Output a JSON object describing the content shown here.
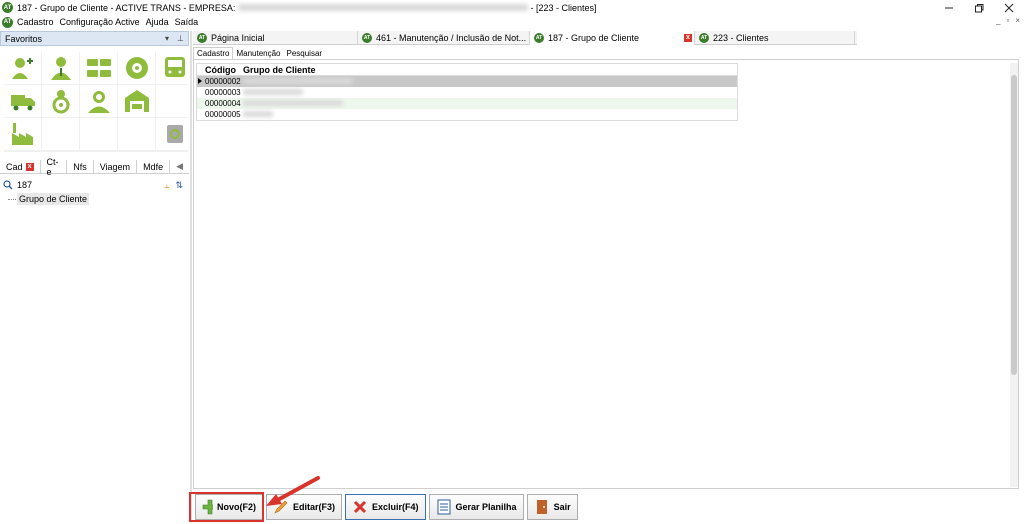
{
  "window": {
    "title_prefix": "187 - Grupo de Cliente - ACTIVE TRANS - EMPRESA:",
    "title_suffix": "- [223 - Clientes]",
    "logo_text": "AT"
  },
  "menu": {
    "items": [
      "Cadastro",
      "Configuração Active",
      "Ajuda",
      "Saída"
    ]
  },
  "favorites": {
    "title": "Favoritos",
    "icons": [
      "add-user-icon",
      "user-icon",
      "bus-fleet-icon",
      "tire-icon",
      "bus-front-icon",
      "truck-icon",
      "driver-icon",
      "mechanic-icon",
      "garage-icon",
      "factory-icon",
      "recycle-icon"
    ]
  },
  "categories": {
    "tabs": [
      "Cad",
      "Ct-e",
      "Nfs",
      "Viagem",
      "Mdfe"
    ]
  },
  "search": {
    "value": "187"
  },
  "tree": {
    "node": "Grupo de Cliente"
  },
  "doc_tabs": [
    {
      "label": "Página Inicial"
    },
    {
      "label": "461 - Manutenção / Inclusão de Not..."
    },
    {
      "label": "187 - Grupo de Cliente"
    },
    {
      "label": "223 - Clientes"
    }
  ],
  "sub_tabs": [
    "Cadastro",
    "Manutenção",
    "Pesquisar"
  ],
  "grid": {
    "columns": [
      "Código",
      "Grupo de Cliente"
    ],
    "rows": [
      {
        "code": "00000002",
        "name": ""
      },
      {
        "code": "00000003",
        "name": ""
      },
      {
        "code": "00000004",
        "name": ""
      },
      {
        "code": "00000005",
        "name": ""
      }
    ]
  },
  "toolbar": {
    "novo": "Novo(F2)",
    "editar": "Editar(F3)",
    "excluir": "Excluir(F4)",
    "gerar": "Gerar Planilha",
    "sair": "Sair"
  },
  "colors": {
    "brand_green": "#3c7d2c",
    "icon_green": "#8fbc3c",
    "highlight_red": "#d9342b"
  }
}
